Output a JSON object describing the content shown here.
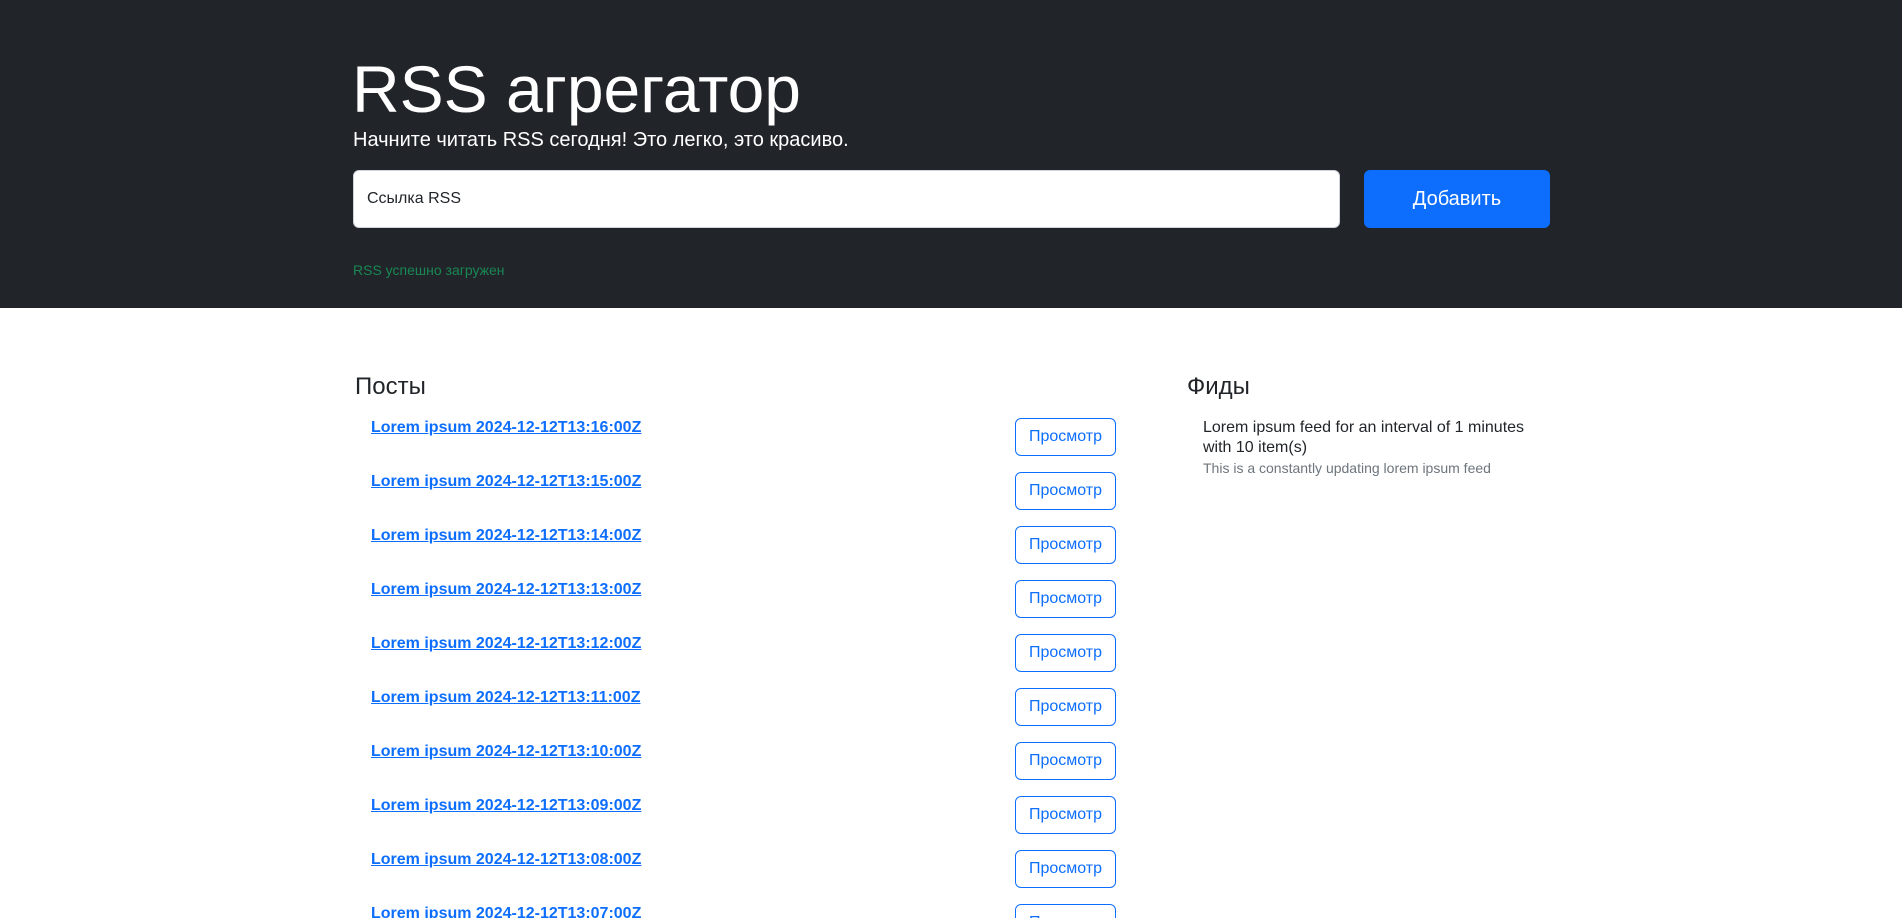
{
  "hero": {
    "title": "RSS агрегатор",
    "lead": "Начните читать RSS сегодня! Это легко, это красиво.",
    "input_placeholder": "Ссылка RSS",
    "add_button": "Добавить",
    "feedback": "RSS успешно загружен"
  },
  "posts": {
    "title": "Посты",
    "view_label": "Просмотр",
    "items": [
      {
        "title": "Lorem ipsum 2024-12-12T13:16:00Z"
      },
      {
        "title": "Lorem ipsum 2024-12-12T13:15:00Z"
      },
      {
        "title": "Lorem ipsum 2024-12-12T13:14:00Z"
      },
      {
        "title": "Lorem ipsum 2024-12-12T13:13:00Z"
      },
      {
        "title": "Lorem ipsum 2024-12-12T13:12:00Z"
      },
      {
        "title": "Lorem ipsum 2024-12-12T13:11:00Z"
      },
      {
        "title": "Lorem ipsum 2024-12-12T13:10:00Z"
      },
      {
        "title": "Lorem ipsum 2024-12-12T13:09:00Z"
      },
      {
        "title": "Lorem ipsum 2024-12-12T13:08:00Z"
      },
      {
        "title": "Lorem ipsum 2024-12-12T13:07:00Z"
      }
    ]
  },
  "feeds": {
    "title": "Фиды",
    "items": [
      {
        "title": "Lorem ipsum feed for an interval of 1 minutes with 10 item(s)",
        "description": "This is a constantly updating lorem ipsum feed"
      }
    ]
  },
  "colors": {
    "hero_bg": "#212529",
    "primary": "#0d6efd",
    "success": "#198754",
    "muted": "#6c757d"
  }
}
